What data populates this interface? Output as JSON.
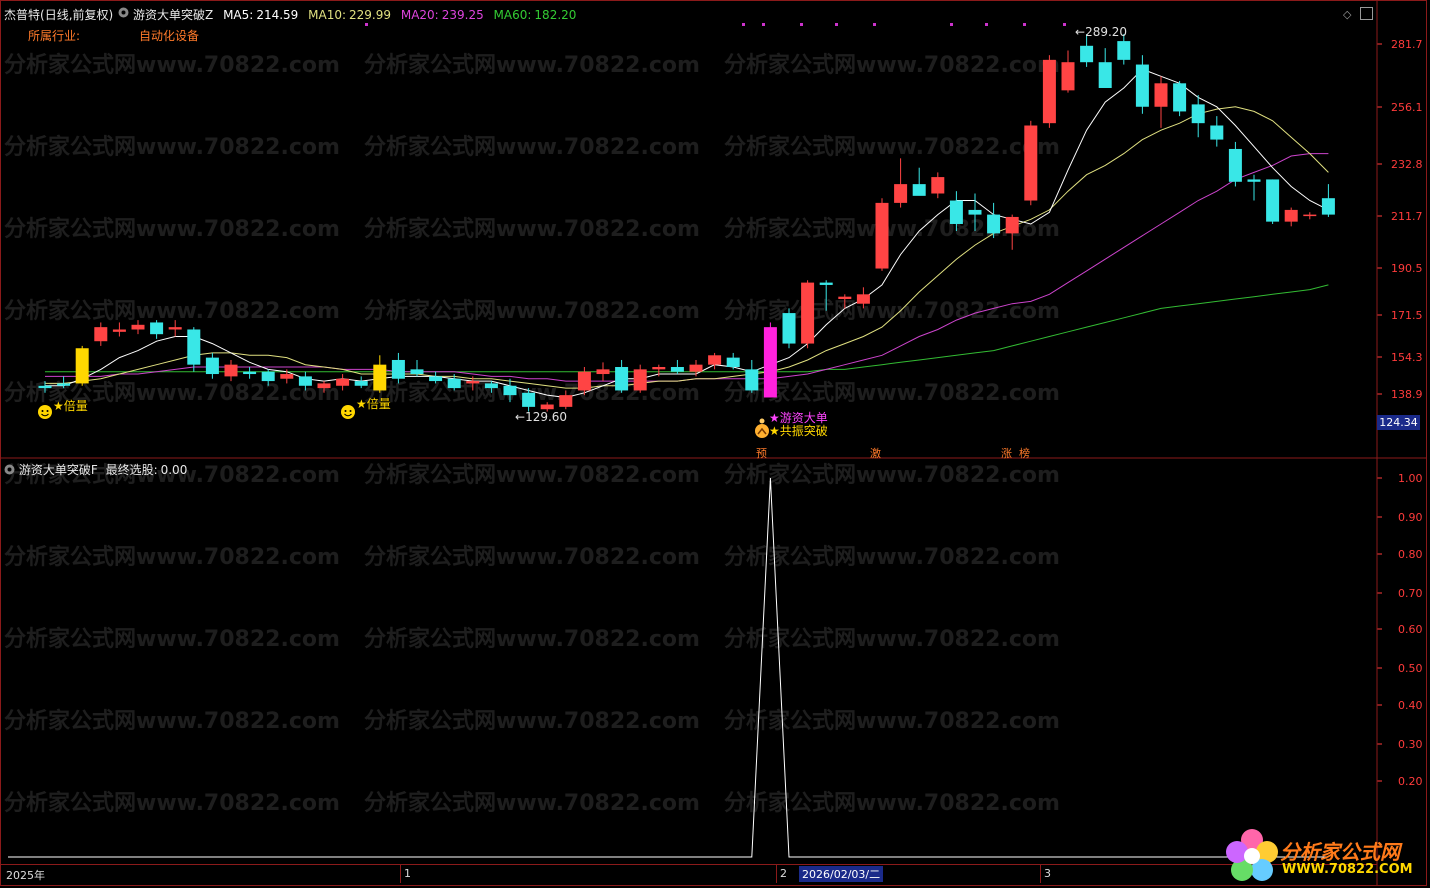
{
  "header": {
    "stock_name": "杰普特",
    "period": "(日线,前复权)",
    "indicator_name": "游资大单突破Z",
    "ma5_label": "MA5:",
    "ma5_value": "214.59",
    "ma10_label": "MA10:",
    "ma10_value": "229.99",
    "ma20_label": "MA20:",
    "ma20_value": "239.25",
    "ma60_label": "MA60:",
    "ma60_value": "182.20",
    "industry_label": "所属行业:",
    "industry_value": "自动化设备"
  },
  "colors": {
    "up": "#ff4444",
    "down": "#39e7e7",
    "ma5": "#ffffff",
    "ma10": "#e0e080",
    "ma20": "#cc44cc",
    "ma60": "#33bb33",
    "axis": "#ff3b3b",
    "background": "#000000"
  },
  "price_axis": [
    "281.7",
    "256.1",
    "232.8",
    "211.7",
    "190.5",
    "171.5",
    "154.3",
    "138.9"
  ],
  "current_price": "124.34",
  "annotations": {
    "high_label": "289.20",
    "low_label": "129.60",
    "beiliang_1": "★倍量",
    "beiliang_2": "★倍量",
    "youzi_dadan": "★游资大单",
    "gongzhen_tupo": "★共振突破",
    "tag_yu": "预",
    "tag_ji": "激",
    "tag_zhang": "涨",
    "tag_bang": "榜"
  },
  "lower_panel": {
    "indicator_name": "游资大单突破F",
    "label": "最终选股:",
    "value": "0.00",
    "axis": [
      "1.00",
      "0.90",
      "0.80",
      "0.70",
      "0.60",
      "0.50",
      "0.40",
      "0.30",
      "0.20"
    ]
  },
  "time_axis": {
    "year": "2025年",
    "m1": "1",
    "m2": "2",
    "date": "2026/02/03/二",
    "m3": "3"
  },
  "watermark": {
    "text": "分析家公式网www.70822.com",
    "logo_cn": "分析家公式网",
    "logo_url": "WWW.70822.COM"
  },
  "chart_data": {
    "type": "candlestick",
    "ylim": [
      118,
      295
    ],
    "candles": [
      {
        "o": 139,
        "h": 141,
        "l": 136,
        "c": 138
      },
      {
        "o": 140,
        "h": 143,
        "l": 138,
        "c": 139
      },
      {
        "o": 140,
        "h": 156,
        "l": 139,
        "c": 155
      },
      {
        "o": 158,
        "h": 166,
        "l": 156,
        "c": 164
      },
      {
        "o": 162,
        "h": 166,
        "l": 160,
        "c": 163
      },
      {
        "o": 163,
        "h": 167,
        "l": 161,
        "c": 165
      },
      {
        "o": 166,
        "h": 167,
        "l": 159,
        "c": 161
      },
      {
        "o": 163,
        "h": 167,
        "l": 160,
        "c": 164
      },
      {
        "o": 163,
        "h": 164,
        "l": 145,
        "c": 148
      },
      {
        "o": 151,
        "h": 153,
        "l": 142,
        "c": 144
      },
      {
        "o": 143,
        "h": 150,
        "l": 141,
        "c": 148
      },
      {
        "o": 145,
        "h": 147,
        "l": 142,
        "c": 144
      },
      {
        "o": 145,
        "h": 146,
        "l": 139,
        "c": 141
      },
      {
        "o": 142,
        "h": 146,
        "l": 140,
        "c": 144
      },
      {
        "o": 143,
        "h": 145,
        "l": 137,
        "c": 139
      },
      {
        "o": 138,
        "h": 141,
        "l": 136,
        "c": 140
      },
      {
        "o": 139,
        "h": 144,
        "l": 137,
        "c": 142
      },
      {
        "o": 141,
        "h": 143,
        "l": 138,
        "c": 139
      },
      {
        "o": 137,
        "h": 152,
        "l": 136,
        "c": 148
      },
      {
        "o": 150,
        "h": 153,
        "l": 140,
        "c": 142
      },
      {
        "o": 146,
        "h": 150,
        "l": 143,
        "c": 144
      },
      {
        "o": 143,
        "h": 145,
        "l": 140,
        "c": 141
      },
      {
        "o": 142,
        "h": 144,
        "l": 137,
        "c": 138
      },
      {
        "o": 140,
        "h": 143,
        "l": 137,
        "c": 141
      },
      {
        "o": 140,
        "h": 141,
        "l": 136,
        "c": 138
      },
      {
        "o": 139,
        "h": 142,
        "l": 132,
        "c": 135
      },
      {
        "o": 136,
        "h": 138,
        "l": 128,
        "c": 130
      },
      {
        "o": 129,
        "h": 132,
        "l": 128,
        "c": 131
      },
      {
        "o": 130,
        "h": 137,
        "l": 129,
        "c": 135
      },
      {
        "o": 137,
        "h": 147,
        "l": 135,
        "c": 145
      },
      {
        "o": 144,
        "h": 149,
        "l": 141,
        "c": 146
      },
      {
        "o": 147,
        "h": 150,
        "l": 136,
        "c": 137
      },
      {
        "o": 137,
        "h": 148,
        "l": 136,
        "c": 146
      },
      {
        "o": 146,
        "h": 148,
        "l": 143,
        "c": 147
      },
      {
        "o": 147,
        "h": 150,
        "l": 144,
        "c": 145
      },
      {
        "o": 145,
        "h": 150,
        "l": 143,
        "c": 148
      },
      {
        "o": 148,
        "h": 153,
        "l": 146,
        "c": 152
      },
      {
        "o": 151,
        "h": 153,
        "l": 146,
        "c": 147
      },
      {
        "o": 146,
        "h": 150,
        "l": 136,
        "c": 137
      },
      {
        "o": 134,
        "h": 166,
        "l": 134,
        "c": 164
      },
      {
        "o": 170,
        "h": 172,
        "l": 155,
        "c": 157
      },
      {
        "o": 157,
        "h": 184,
        "l": 155,
        "c": 183
      },
      {
        "o": 183,
        "h": 184,
        "l": 171,
        "c": 182
      },
      {
        "o": 176,
        "h": 178,
        "l": 172,
        "c": 177
      },
      {
        "o": 174,
        "h": 181,
        "l": 172,
        "c": 178
      },
      {
        "o": 189,
        "h": 219,
        "l": 188,
        "c": 217
      },
      {
        "o": 217,
        "h": 236,
        "l": 215,
        "c": 225
      },
      {
        "o": 225,
        "h": 232,
        "l": 221,
        "c": 220
      },
      {
        "o": 221,
        "h": 230,
        "l": 219,
        "c": 228
      },
      {
        "o": 218,
        "h": 222,
        "l": 205,
        "c": 208
      },
      {
        "o": 214,
        "h": 221,
        "l": 205,
        "c": 212
      },
      {
        "o": 212,
        "h": 217,
        "l": 202,
        "c": 204
      },
      {
        "o": 204,
        "h": 212,
        "l": 197,
        "c": 211
      },
      {
        "o": 218,
        "h": 252,
        "l": 216,
        "c": 250
      },
      {
        "o": 251,
        "h": 280,
        "l": 249,
        "c": 278
      },
      {
        "o": 265,
        "h": 282,
        "l": 264,
        "c": 277
      },
      {
        "o": 284,
        "h": 289,
        "l": 275,
        "c": 277
      },
      {
        "o": 277,
        "h": 283,
        "l": 266,
        "c": 266
      },
      {
        "o": 286,
        "h": 289,
        "l": 276,
        "c": 278
      },
      {
        "o": 276,
        "h": 280,
        "l": 255,
        "c": 258
      },
      {
        "o": 258,
        "h": 271,
        "l": 249,
        "c": 268
      },
      {
        "o": 268,
        "h": 269,
        "l": 254,
        "c": 256
      },
      {
        "o": 259,
        "h": 263,
        "l": 245,
        "c": 251
      },
      {
        "o": 250,
        "h": 254,
        "l": 241,
        "c": 244
      },
      {
        "o": 240,
        "h": 243,
        "l": 224,
        "c": 226
      },
      {
        "o": 227,
        "h": 229,
        "l": 218,
        "c": 226
      },
      {
        "o": 227,
        "h": 227,
        "l": 208,
        "c": 209
      },
      {
        "o": 209,
        "h": 215,
        "l": 207,
        "c": 214
      },
      {
        "o": 212,
        "h": 213,
        "l": 210,
        "c": 212
      },
      {
        "o": 219,
        "h": 225,
        "l": 211,
        "c": 212
      }
    ],
    "special_candles": {
      "yellow": [
        2,
        18
      ],
      "magenta": [
        39
      ]
    },
    "ma5": [
      139,
      139,
      142,
      146,
      151,
      154,
      158,
      160,
      160,
      157,
      153,
      149,
      146,
      145,
      142,
      141,
      142,
      141,
      142,
      143,
      143,
      143,
      142,
      141,
      141,
      139,
      137,
      135,
      134,
      136,
      139,
      142,
      142,
      144,
      144,
      144,
      148,
      147,
      145,
      148,
      151,
      157,
      165,
      172,
      176,
      182,
      195,
      205,
      212,
      218,
      218,
      212,
      210,
      208,
      213,
      231,
      248,
      260,
      266,
      274,
      271,
      268,
      262,
      258,
      250,
      241,
      232,
      224,
      218,
      214
    ],
    "ma10": [
      140,
      140,
      141,
      142,
      144,
      146,
      148,
      150,
      152,
      153,
      153,
      152,
      152,
      151,
      148,
      147,
      146,
      144,
      144,
      144,
      144,
      143,
      143,
      142,
      142,
      141,
      140,
      139,
      138,
      138,
      139,
      139,
      140,
      141,
      141,
      142,
      142,
      143,
      144,
      145,
      147,
      150,
      154,
      157,
      160,
      164,
      171,
      179,
      186,
      193,
      199,
      204,
      207,
      210,
      214,
      222,
      229,
      233,
      238,
      244,
      248,
      251,
      255,
      257,
      258,
      256,
      252,
      245,
      238,
      230
    ],
    "ma20": [
      143,
      143,
      143,
      143,
      144,
      144,
      145,
      146,
      147,
      147,
      147,
      147,
      147,
      147,
      147,
      147,
      146,
      146,
      146,
      145,
      145,
      145,
      145,
      144,
      143,
      143,
      142,
      142,
      141,
      141,
      141,
      141,
      141,
      141,
      141,
      142,
      142,
      142,
      142,
      142,
      143,
      144,
      146,
      148,
      150,
      152,
      156,
      160,
      163,
      167,
      170,
      172,
      174,
      175,
      178,
      183,
      188,
      193,
      198,
      203,
      208,
      213,
      218,
      222,
      227,
      230,
      233,
      237,
      238,
      238
    ],
    "ma60": [
      145,
      145,
      145,
      145,
      145,
      145,
      145,
      145,
      145,
      145,
      145,
      145,
      145,
      145,
      145,
      145,
      145,
      145,
      145,
      145,
      145,
      145,
      145,
      145,
      145,
      145,
      145,
      145,
      145,
      145,
      145,
      145,
      145,
      145,
      145,
      145,
      145,
      145,
      145,
      145,
      145,
      145,
      146,
      146,
      147,
      148,
      149,
      150,
      151,
      152,
      153,
      154,
      156,
      158,
      160,
      162,
      164,
      166,
      168,
      170,
      172,
      173,
      174,
      175,
      176,
      177,
      178,
      179,
      180,
      182
    ],
    "lower_series": [
      0,
      0,
      0,
      0,
      0,
      0,
      0,
      0,
      0,
      0,
      0,
      0,
      0,
      0,
      0,
      0,
      0,
      0,
      0,
      0,
      0,
      0,
      0,
      0,
      0,
      0,
      0,
      0,
      0,
      0,
      0,
      0,
      0,
      0,
      0,
      0,
      0,
      0,
      0,
      1,
      0,
      0,
      0,
      0,
      0,
      0,
      0,
      0,
      0,
      0,
      0,
      0,
      0,
      0,
      0,
      0,
      0,
      0,
      0,
      0,
      0,
      0,
      0,
      0,
      0,
      0,
      0,
      0,
      0,
      0
    ]
  }
}
